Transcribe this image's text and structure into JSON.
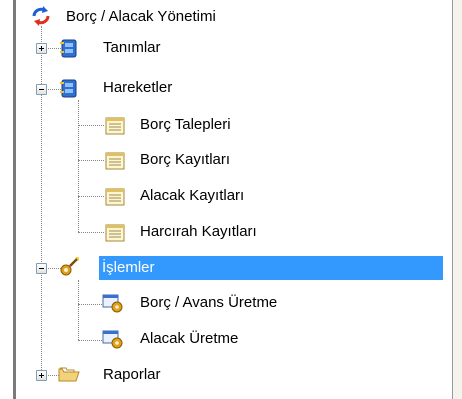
{
  "tree": {
    "root": {
      "label": "Borç / Alacak Yönetimi",
      "icon": "refresh-arrows-icon"
    },
    "tanimlar": {
      "label": "Tanımlar",
      "icon": "blue-folder-icon",
      "expanded": false
    },
    "hareketler": {
      "label": "Hareketler",
      "icon": "blue-folder-icon",
      "expanded": true,
      "children": [
        {
          "label": "Borç Talepleri",
          "icon": "form-icon"
        },
        {
          "label": "Borç Kayıtları",
          "icon": "form-icon"
        },
        {
          "label": "Alacak Kayıtları",
          "icon": "form-icon"
        },
        {
          "label": "Harcırah Kayıtları",
          "icon": "form-icon"
        }
      ]
    },
    "islemler": {
      "label": "İşlemler",
      "icon": "gear-wand-icon",
      "expanded": true,
      "selected": true,
      "children": [
        {
          "label": "Borç / Avans Üretme",
          "icon": "window-gear-icon"
        },
        {
          "label": "Alacak Üretme",
          "icon": "window-gear-icon"
        }
      ]
    },
    "raporlar": {
      "label": "Raporlar",
      "icon": "open-folder-icon",
      "expanded": false
    }
  },
  "colors": {
    "selection": "#3399ff",
    "selection_text": "#ffffff",
    "tree_lines": "#888888"
  }
}
